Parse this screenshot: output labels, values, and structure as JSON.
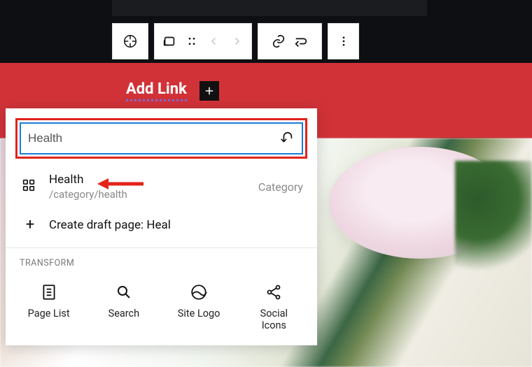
{
  "addlink": {
    "label": "Add Link"
  },
  "search": {
    "value": "Health"
  },
  "result": {
    "title": "Health",
    "path": "/category/health",
    "type": "Category"
  },
  "create": {
    "prefix": "Create draft page: ",
    "term": "Heal"
  },
  "transform": {
    "heading": "TRANSFORM",
    "items": [
      {
        "label": "Page List"
      },
      {
        "label": "Search"
      },
      {
        "label": "Site Logo"
      },
      {
        "label": "Social\nIcons"
      }
    ]
  }
}
